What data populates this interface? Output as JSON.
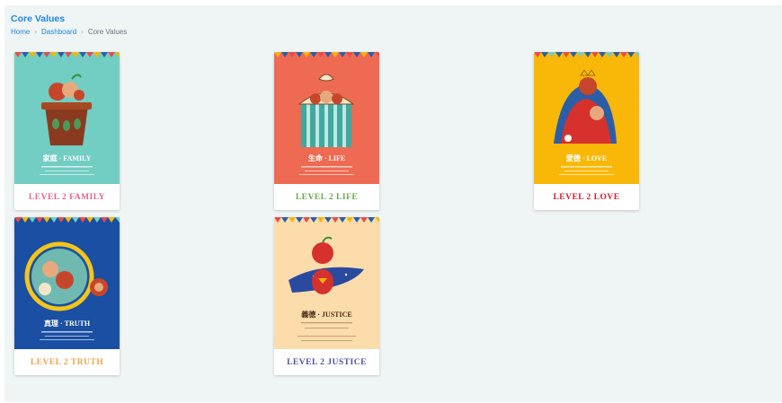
{
  "header": {
    "title": "Core Values"
  },
  "breadcrumb": {
    "home": "Home",
    "dashboard": "Dashboard",
    "current": "Core Values"
  },
  "cards": [
    {
      "poster_title": "家庭 · FAMILY",
      "label": "LEVEL 2 FAMILY",
      "bg": "#72cdc2",
      "label_color": "#e0648e"
    },
    {
      "poster_title": "生命 · LIFE",
      "label": "LEVEL 2 LIFE",
      "bg": "#ef6a52",
      "label_color": "#6aa84f"
    },
    {
      "poster_title": "愛德 · LOVE",
      "label": "LEVEL 2 LOVE",
      "bg": "#f9b708",
      "label_color": "#d01f2e"
    },
    {
      "poster_title": "真理 · TRUTH",
      "label": "LEVEL 2 TRUTH",
      "bg": "#1a4fa3",
      "label_color": "#f0a24b"
    },
    {
      "poster_title": "義德 · JUSTICE",
      "label": "LEVEL 2 JUSTICE",
      "bg": "#fcdcaa",
      "label_color": "#4b4fa0"
    }
  ]
}
